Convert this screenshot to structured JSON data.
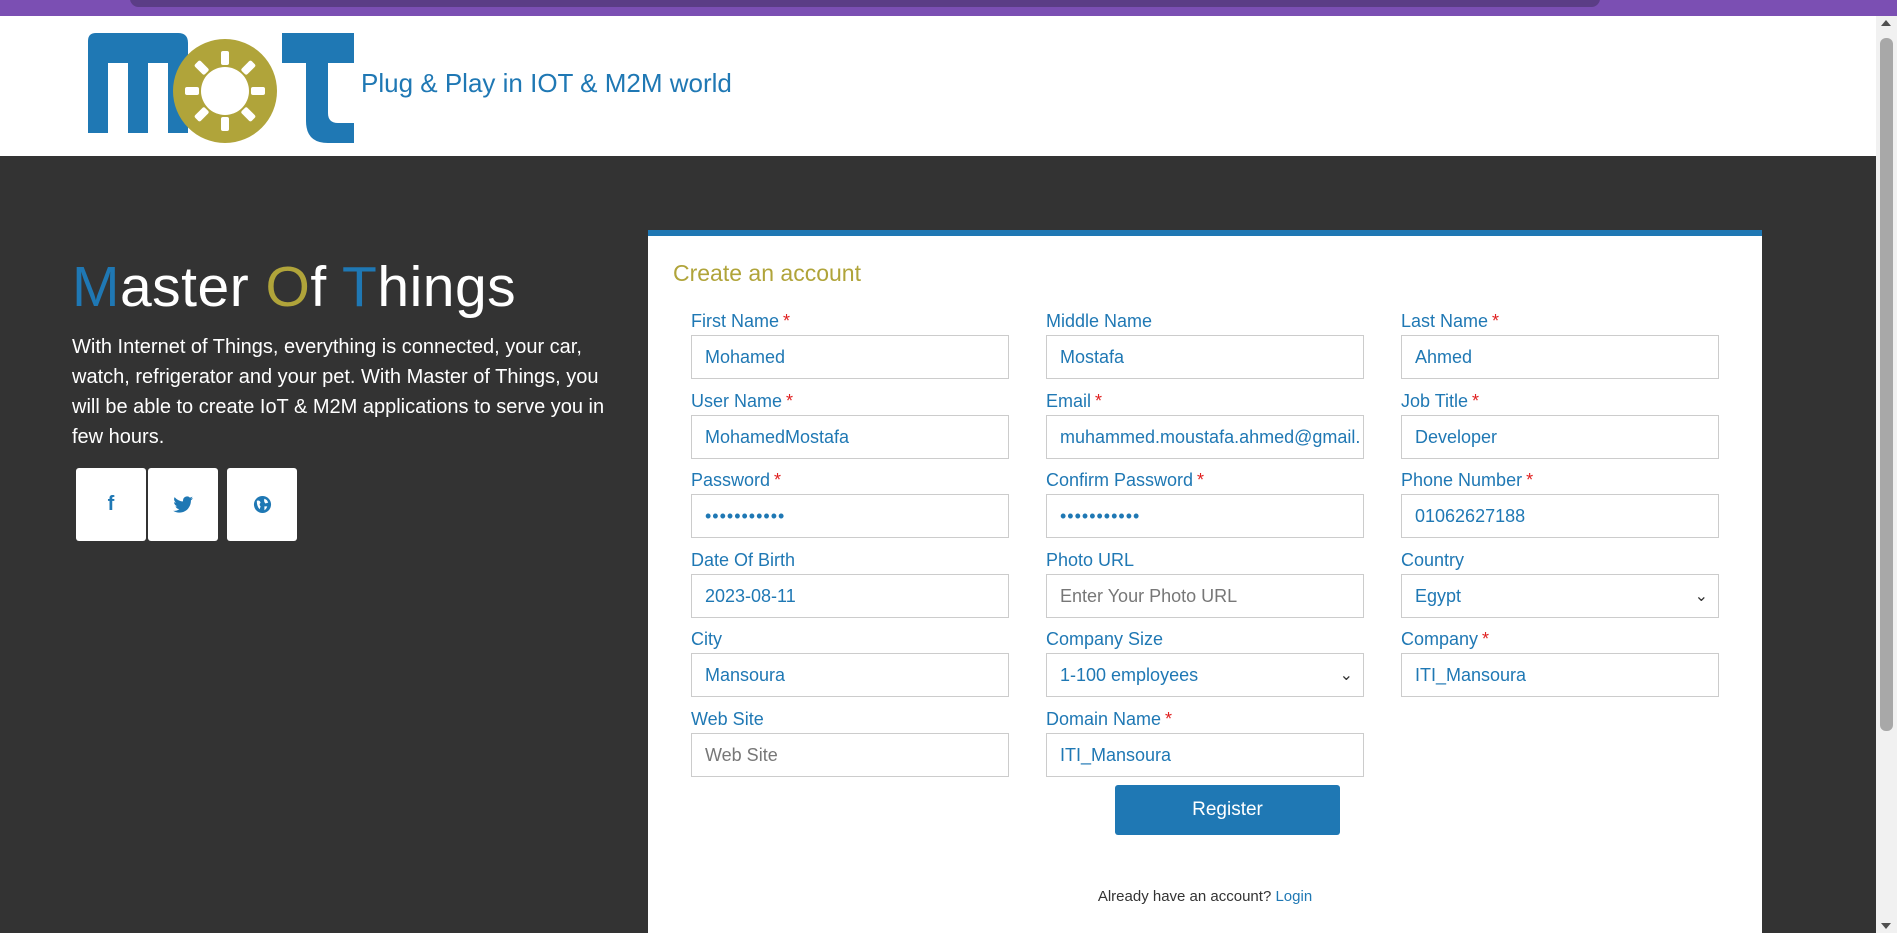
{
  "header": {
    "logo_text": "mot",
    "tagline": "Plug & Play in IOT & M2M world"
  },
  "hero": {
    "title_parts": [
      "M",
      "aster ",
      "O",
      "f ",
      "T",
      "hings"
    ],
    "description": "With Internet of Things, everything is connected, your car, watch, refrigerator and your pet. With Master of Things, you will be able to create IoT & M2M applications to serve you in few hours."
  },
  "social": [
    {
      "icon": "facebook-icon",
      "glyph": "f"
    },
    {
      "icon": "twitter-icon",
      "glyph": "🐦"
    },
    {
      "icon": "globe-icon",
      "glyph": "🌐"
    }
  ],
  "form": {
    "title": "Create an account",
    "required_mark": "*",
    "fields": {
      "first_name": {
        "label": "First Name",
        "value": "Mohamed",
        "required": true
      },
      "middle_name": {
        "label": "Middle Name",
        "value": "Mostafa",
        "required": false
      },
      "last_name": {
        "label": "Last Name",
        "value": "Ahmed",
        "required": true
      },
      "user_name": {
        "label": "User Name",
        "value": "MohamedMostafa",
        "required": true
      },
      "email": {
        "label": "Email",
        "value": "muhammed.moustafa.ahmed@gmail.",
        "required": true
      },
      "job_title": {
        "label": "Job Title",
        "value": "Developer",
        "required": true
      },
      "password": {
        "label": "Password",
        "value": "•••••••••••",
        "required": true
      },
      "confirm_password": {
        "label": "Confirm Password",
        "value": "•••••••••••",
        "required": true
      },
      "phone_number": {
        "label": "Phone Number",
        "value": "01062627188",
        "required": true
      },
      "date_of_birth": {
        "label": "Date Of Birth",
        "value": "2023-08-11",
        "required": false
      },
      "photo_url": {
        "label": "Photo URL",
        "placeholder": "Enter Your Photo URL",
        "required": false
      },
      "country": {
        "label": "Country",
        "value": "Egypt",
        "required": false
      },
      "city": {
        "label": "City",
        "value": "Mansoura",
        "required": false
      },
      "company_size": {
        "label": "Company Size",
        "value": "1-100 employees",
        "required": false
      },
      "company": {
        "label": "Company",
        "value": "ITI_Mansoura",
        "required": true
      },
      "web_site": {
        "label": "Web Site",
        "placeholder": "Web Site",
        "required": false
      },
      "domain_name": {
        "label": "Domain Name",
        "value": "ITI_Mansoura",
        "required": true
      }
    },
    "register_label": "Register",
    "login_prompt": "Already have an account?",
    "login_link": "Login"
  },
  "colors": {
    "brand_blue": "#1f78b4",
    "brand_olive": "#b0a43a",
    "dark_bg": "#333333",
    "required_red": "#e02020"
  }
}
